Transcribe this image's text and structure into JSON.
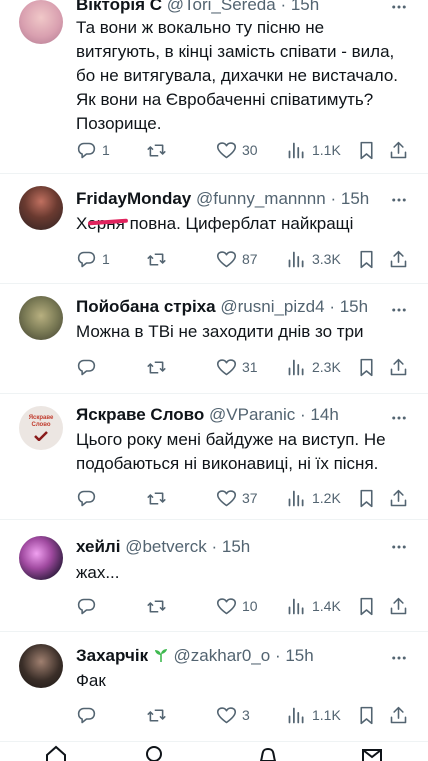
{
  "tweets": [
    {
      "name": "Вікторія С",
      "handle": "@Tori_Sereda",
      "time": "15h",
      "text": "Та вони ж вокально ту пісню не витягують, в кінці замість співати - вила, бо не витягувала, дихачки не вистачало. Як вони на Євробаченні співатимуть? Позорище.",
      "replies": "1",
      "retweets": "",
      "likes": "30",
      "views": "1.1K",
      "avatar_color": "#d9a0b0"
    },
    {
      "name": "FridayMonday",
      "handle": "@funny_mannnn",
      "time": "15h",
      "text": "Херня повна. Циферблат найкращі",
      "replies": "1",
      "retweets": "",
      "likes": "87",
      "views": "3.3K",
      "avatar_color": "#5a3a30"
    },
    {
      "name": "Пойобана стріха",
      "handle": "@rusni_pizd4",
      "time": "15h",
      "text": "Можна в ТВі не заходити днів зо три",
      "replies": "",
      "retweets": "",
      "likes": "31",
      "views": "2.3K",
      "avatar_color": "#7a7a55"
    },
    {
      "name": "Яскраве Слово",
      "handle": "@VParanic",
      "time": "14h",
      "text": "Цього року мені байдуже на виступ. Не подобаються ні виконавиці, ні їх пісня.",
      "replies": "",
      "retweets": "",
      "likes": "37",
      "views": "1.2K",
      "avatar_color": "#ece6e2",
      "avatar_text": "Яскраве Слово"
    },
    {
      "name": "хейлі",
      "handle": "@betverck",
      "time": "15h",
      "text": "жах...",
      "replies": "",
      "retweets": "",
      "likes": "10",
      "views": "1.4K",
      "avatar_color": "#a04aa0"
    },
    {
      "name": "Захарчік",
      "handle": "@zakhar0_o",
      "time": "15h",
      "text": "Фак",
      "replies": "",
      "retweets": "",
      "likes": "3",
      "views": "1.1K",
      "avatar_color": "#3a2e28"
    }
  ],
  "colors": {
    "secondary": "#536471",
    "border": "#eff3f4",
    "redaction": "#e0245e",
    "sprout": "#3fb950"
  },
  "icons": {
    "reply": "reply-icon",
    "retweet": "retweet-icon",
    "like": "heart-icon",
    "views": "views-icon",
    "bookmark": "bookmark-icon",
    "share": "share-icon",
    "more": "more-icon"
  }
}
